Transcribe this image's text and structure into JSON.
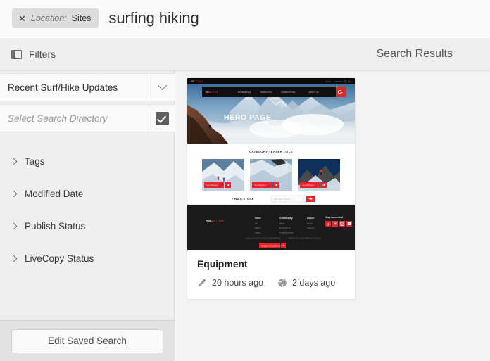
{
  "topbar": {
    "close_icon": "close-icon",
    "location_label": "Location:",
    "location_value": "Sites",
    "search_term": "surfing hiking"
  },
  "subheader": {
    "panel_icon": "panel-toggle-icon",
    "filters_title": "Filters",
    "results_title": "Search Results"
  },
  "sidebar": {
    "saved_search": {
      "value": "Recent Surf/Hike Updates",
      "chevron_icon": "chevron-down-icon"
    },
    "directory": {
      "placeholder": "Select Search Directory",
      "checkbox_icon": "checkmark-icon",
      "checked": true
    },
    "accordion": [
      {
        "label": "Tags",
        "icon": "chevron-right-icon",
        "expanded": false
      },
      {
        "label": "Modified Date",
        "icon": "chevron-right-icon",
        "expanded": false
      },
      {
        "label": "Publish Status",
        "icon": "chevron-right-icon",
        "expanded": false
      },
      {
        "label": "LiveCopy Status",
        "icon": "chevron-right-icon",
        "expanded": false
      }
    ],
    "edit_saved_search_label": "Edit Saved Search"
  },
  "results": {
    "cards": [
      {
        "title": "Equipment",
        "modified": {
          "icon": "pencil-icon",
          "text": "20 hours ago"
        },
        "published": {
          "icon": "globe-icon",
          "text": "2 days ago"
        }
      }
    ]
  },
  "thumbnail": {
    "brand": "WE.ACTIVE",
    "hero_heading": "HERO PAGE",
    "nav_items": [
      "EXPERIENCE",
      "PRODUCTS",
      "COMMUNITIES",
      "ABOUT US"
    ],
    "teaser_title": "CATEGORY TEASER TITLE",
    "teaser_buttons": [
      "SKI FROM 0",
      "SKI FROM 0",
      "SKI FROM 0"
    ],
    "find_a_store_label": "FIND A STORE",
    "find_a_store_placeholder": "ZIP, City, Country",
    "footer_columns": [
      {
        "heading": "Store",
        "links": [
          "Ski",
          "Winter",
          "Safety"
        ]
      },
      {
        "heading": "Community",
        "links": [
          "Blogs",
          "Discussions",
          "Product Issues"
        ]
      },
      {
        "heading": "About",
        "links": [
          "Brand",
          "Support"
        ]
      }
    ],
    "footer_social_heading": "Stay connected",
    "footer_legal": [
      "© WE.ACTIVE ALL RIGHTS RESERVED",
      "TERMS OF USE & PRIVACY POLICY"
    ],
    "footer_cta": "MAKE IT YOURS NOW"
  },
  "colors": {
    "accent_red": "#e8232a",
    "dark": "#151515",
    "page_bg": "#f4f4f4",
    "panel_bg": "#efefef"
  }
}
